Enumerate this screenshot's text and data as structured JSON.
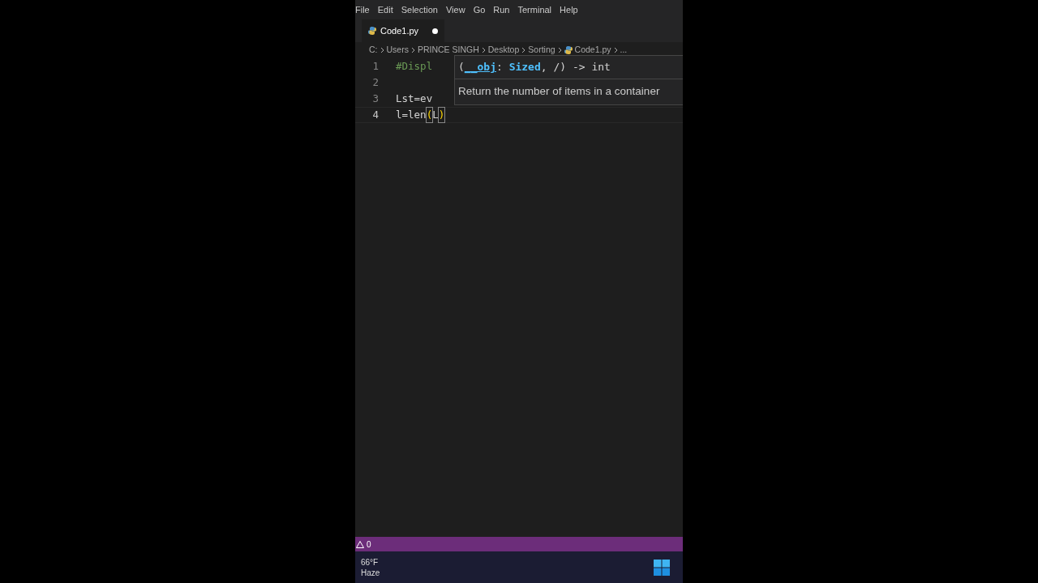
{
  "menu": [
    "File",
    "Edit",
    "Selection",
    "View",
    "Go",
    "Run",
    "Terminal",
    "Help"
  ],
  "tabs": [
    {
      "label": "Code1.py",
      "selected": true,
      "modified": true
    }
  ],
  "breadcrumb": [
    "C:",
    "Users",
    "PRINCE SINGH",
    "Desktop",
    "Sorting",
    "Code1.py",
    "..."
  ],
  "lines": [
    {
      "number": "1",
      "current": false,
      "tokens": [
        {
          "kind": "comment",
          "text": "#Displ"
        }
      ]
    },
    {
      "number": "2",
      "current": false
    },
    {
      "number": "3",
      "current": false,
      "tokens": [
        {
          "kind": "plain",
          "text": "Lst=ev"
        }
      ]
    },
    {
      "number": "4",
      "current": true,
      "tokens": [
        {
          "kind": "plain",
          "text": "l=len"
        },
        {
          "kind": "bracket",
          "text": "("
        },
        {
          "kind": "plain",
          "text": "L"
        },
        {
          "kind": "bracket",
          "text": ")"
        }
      ]
    }
  ],
  "hover": {
    "signature": [
      {
        "kind": "punct",
        "text": "("
      },
      {
        "kind": "param",
        "text": "__obj"
      },
      {
        "kind": "punct",
        "text": ": "
      },
      {
        "kind": "type",
        "text": "Sized"
      },
      {
        "kind": "punct",
        "text": ", /) -> "
      },
      {
        "kind": "plain",
        "text": "int"
      }
    ],
    "description": "Return the number of items in a container"
  },
  "status_bar": {
    "warnings": "0"
  },
  "taskbar": {
    "temperature": "66°F",
    "weather": "Haze"
  }
}
